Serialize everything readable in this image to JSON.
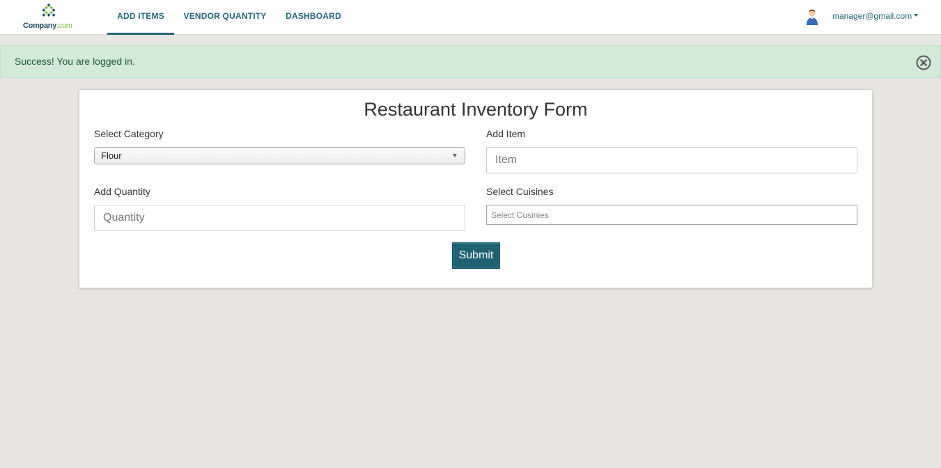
{
  "logo": {
    "brand": "Company",
    "tld": ".com",
    "icon": "diamond-grid-logo-icon",
    "colors": {
      "dark": "#1f4f63",
      "light": "#7fbf3f"
    }
  },
  "nav": {
    "items": [
      {
        "label": "ADD ITEMS",
        "active": true
      },
      {
        "label": "VENDOR QUANTITY",
        "active": false
      },
      {
        "label": "DASHBOARD",
        "active": false
      }
    ],
    "accent": "#22677a"
  },
  "user": {
    "email": "manager@gmail.com",
    "avatar_icon": "user-avatar-icon",
    "menu_icon": "caret-down-icon"
  },
  "alert": {
    "message": "Success! You are logged in.",
    "close_icon": "close-circle-icon",
    "background": "#d4ead9",
    "text_color": "#1f5a2c"
  },
  "form": {
    "title": "Restaurant Inventory Form",
    "category": {
      "label": "Select Category",
      "selected": "Flour"
    },
    "item": {
      "label": "Add Item",
      "placeholder": "Item",
      "value": ""
    },
    "quantity": {
      "label": "Add Quantity",
      "placeholder": "Quantity",
      "value": ""
    },
    "cuisines": {
      "label": "Select Cuisines",
      "placeholder": "Select Cusinies"
    },
    "submit_label": "Submit",
    "submit_color": "#1e6173"
  },
  "page_background": "#e7e6e2"
}
